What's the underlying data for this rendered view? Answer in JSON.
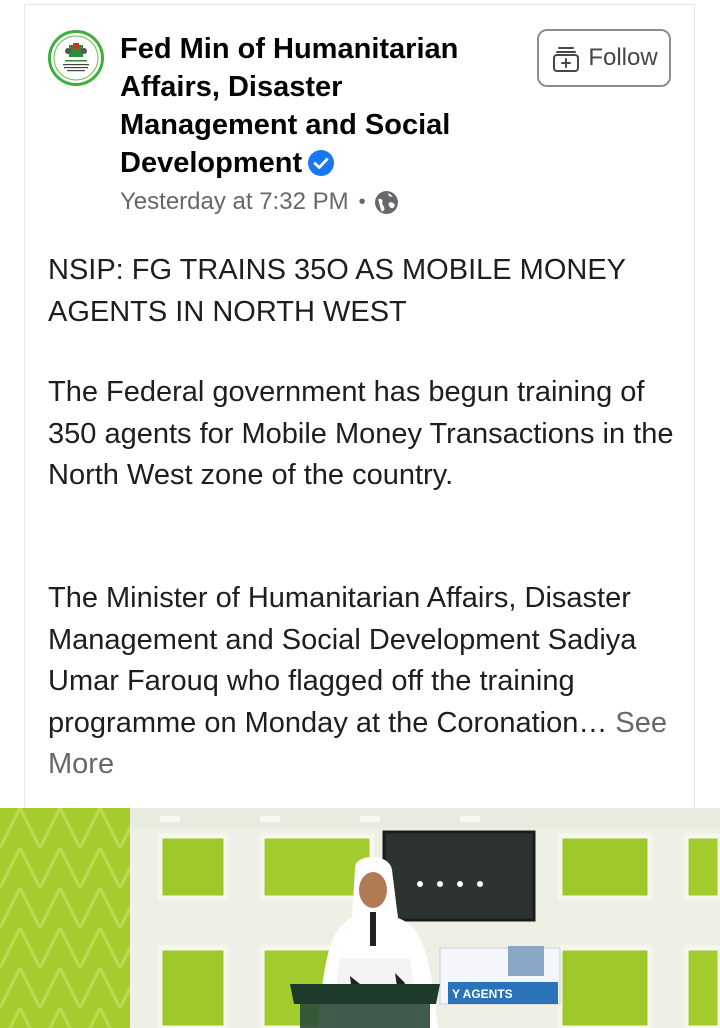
{
  "post": {
    "author": "Fed Min of Humanitarian Affairs, Disaster Management and Social Development",
    "verified": true,
    "timestamp": "Yesterday at 7:32 PM",
    "separator": "•",
    "audience_icon": "globe-icon",
    "follow_label": "Follow",
    "headline": "NSIP: FG TRAINS 35O AS MOBILE MONEY AGENTS IN NORTH WEST",
    "paragraph1": "The Federal government has begun training of 350 agents for Mobile Money Transactions in the North West zone of the country.",
    "paragraph2": "The Minister of Humanitarian Affairs, Disaster Management and Social Development Sadiya Umar Farouq who flagged off the training programme on Monday at the Coronation…",
    "see_more": "See More",
    "banner_text": "Y AGENTS"
  },
  "colors": {
    "verified_blue": "#1877f2",
    "secondary_text": "#65676b",
    "lime_wall": "#a8cd2f"
  }
}
